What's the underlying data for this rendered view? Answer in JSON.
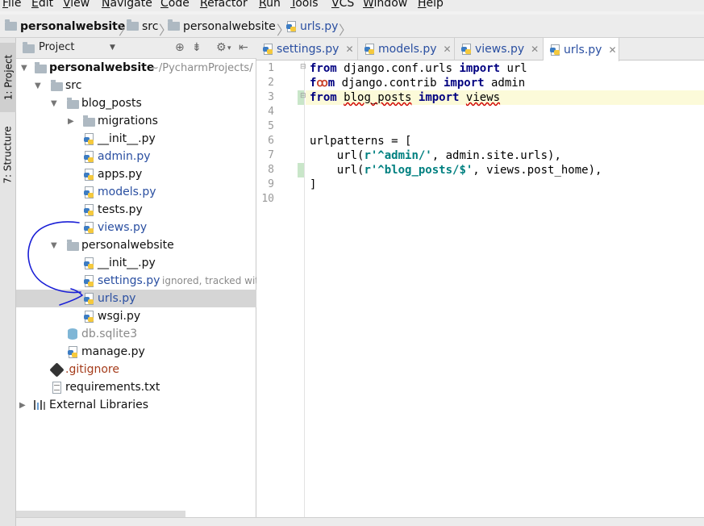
{
  "menu": [
    {
      "label": "File",
      "underline": "F",
      "rest": "ile"
    },
    {
      "label": "Edit",
      "underline": "E",
      "rest": "dit"
    },
    {
      "label": "View",
      "underline": "V",
      "rest": "iew"
    },
    {
      "label": "Navigate",
      "underline": "N",
      "rest": "avigate"
    },
    {
      "label": "Code",
      "underline": "C",
      "rest": "ode"
    },
    {
      "label": "Refactor",
      "underline": "R",
      "rest": "efactor"
    },
    {
      "label": "Run",
      "underline": "R",
      "rest": "un"
    },
    {
      "label": "Tools",
      "underline": "T",
      "rest": "ools"
    },
    {
      "label": "VCS",
      "underline": "V",
      "rest": "CS"
    },
    {
      "label": "Window",
      "underline": "W",
      "rest": "indow"
    },
    {
      "label": "Help",
      "underline": "H",
      "rest": "elp"
    }
  ],
  "breadcrumb": [
    "personalwebsite",
    "src",
    "personalwebsite",
    "urls.py"
  ],
  "tool_tabs": {
    "project": "1: Project",
    "structure": "7: Structure"
  },
  "project_panel": {
    "title": "Project",
    "tree": [
      {
        "label": "personalwebsite",
        "hint": "~/PycharmProjects/"
      },
      {
        "label": "src"
      },
      {
        "label": "blog_posts"
      },
      {
        "label": "migrations"
      },
      {
        "label": "__init__.py"
      },
      {
        "label": "admin.py"
      },
      {
        "label": "apps.py"
      },
      {
        "label": "models.py"
      },
      {
        "label": "tests.py"
      },
      {
        "label": "views.py"
      },
      {
        "label": "personalwebsite"
      },
      {
        "label": "__init__.py"
      },
      {
        "label": "settings.py",
        "hint": "ignored, tracked wit"
      },
      {
        "label": "urls.py"
      },
      {
        "label": "wsgi.py"
      },
      {
        "label": "db.sqlite3"
      },
      {
        "label": "manage.py"
      },
      {
        "label": ".gitignore"
      },
      {
        "label": "requirements.txt"
      },
      {
        "label": "External Libraries"
      }
    ]
  },
  "editor": {
    "tabs": [
      "settings.py",
      "models.py",
      "views.py",
      "urls.py"
    ],
    "active_tab": "urls.py",
    "line_numbers": [
      "1",
      "2",
      "3",
      "4",
      "5",
      "6",
      "7",
      "8",
      "9",
      "10"
    ],
    "code": {
      "l1": {
        "kw1": "from",
        "t1": " django.conf.urls ",
        "kw2": "import",
        "t2": " url"
      },
      "l2": {
        "k1a": "f",
        "bulb": "ꝏ",
        "k1b": "m",
        "t1": " django.contrib ",
        "kw2": "import",
        "t2": " admin"
      },
      "l3": {
        "kw1": "from",
        "sp": " ",
        "mod": "blog_posts",
        "sp2": " ",
        "kw2": "import",
        "sp3": " ",
        "name": "views"
      },
      "l6": "urlpatterns = [",
      "l7": {
        "t1": "    url(",
        "str": "r'^admin/'",
        "t2": ", admin.site.urls),"
      },
      "l8": {
        "t1": "    url(",
        "str": "r'^blog_posts/$'",
        "t2": ", views.post_home),"
      },
      "l9": "]"
    }
  },
  "colors": {
    "annotation": "#1a1fd6",
    "selected_row": "#d5d5d5",
    "current_line": "#fcfad9"
  }
}
